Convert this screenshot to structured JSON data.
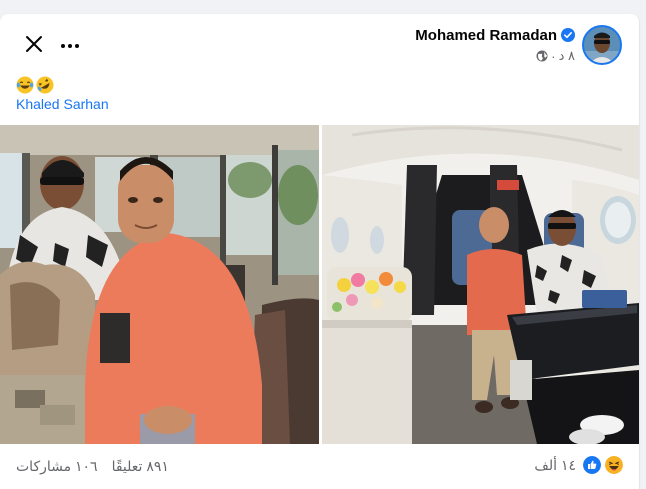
{
  "post": {
    "author": "Mohamed Ramadan",
    "time": "٨ د",
    "privacy_icon": "globe-icon",
    "emojis": [
      "😂",
      "🤣"
    ],
    "mention": "Khaled Sarhan"
  },
  "stats": {
    "reactions_count": "١٤ ألف",
    "comments": "٨٩١ تعليقًا",
    "shares": "١٠٦ مشاركات"
  },
  "colors": {
    "accent": "#1877f2",
    "text_secondary": "#65676b",
    "like_blue": "#1877f2",
    "haha_yellow": "#f7b125"
  }
}
